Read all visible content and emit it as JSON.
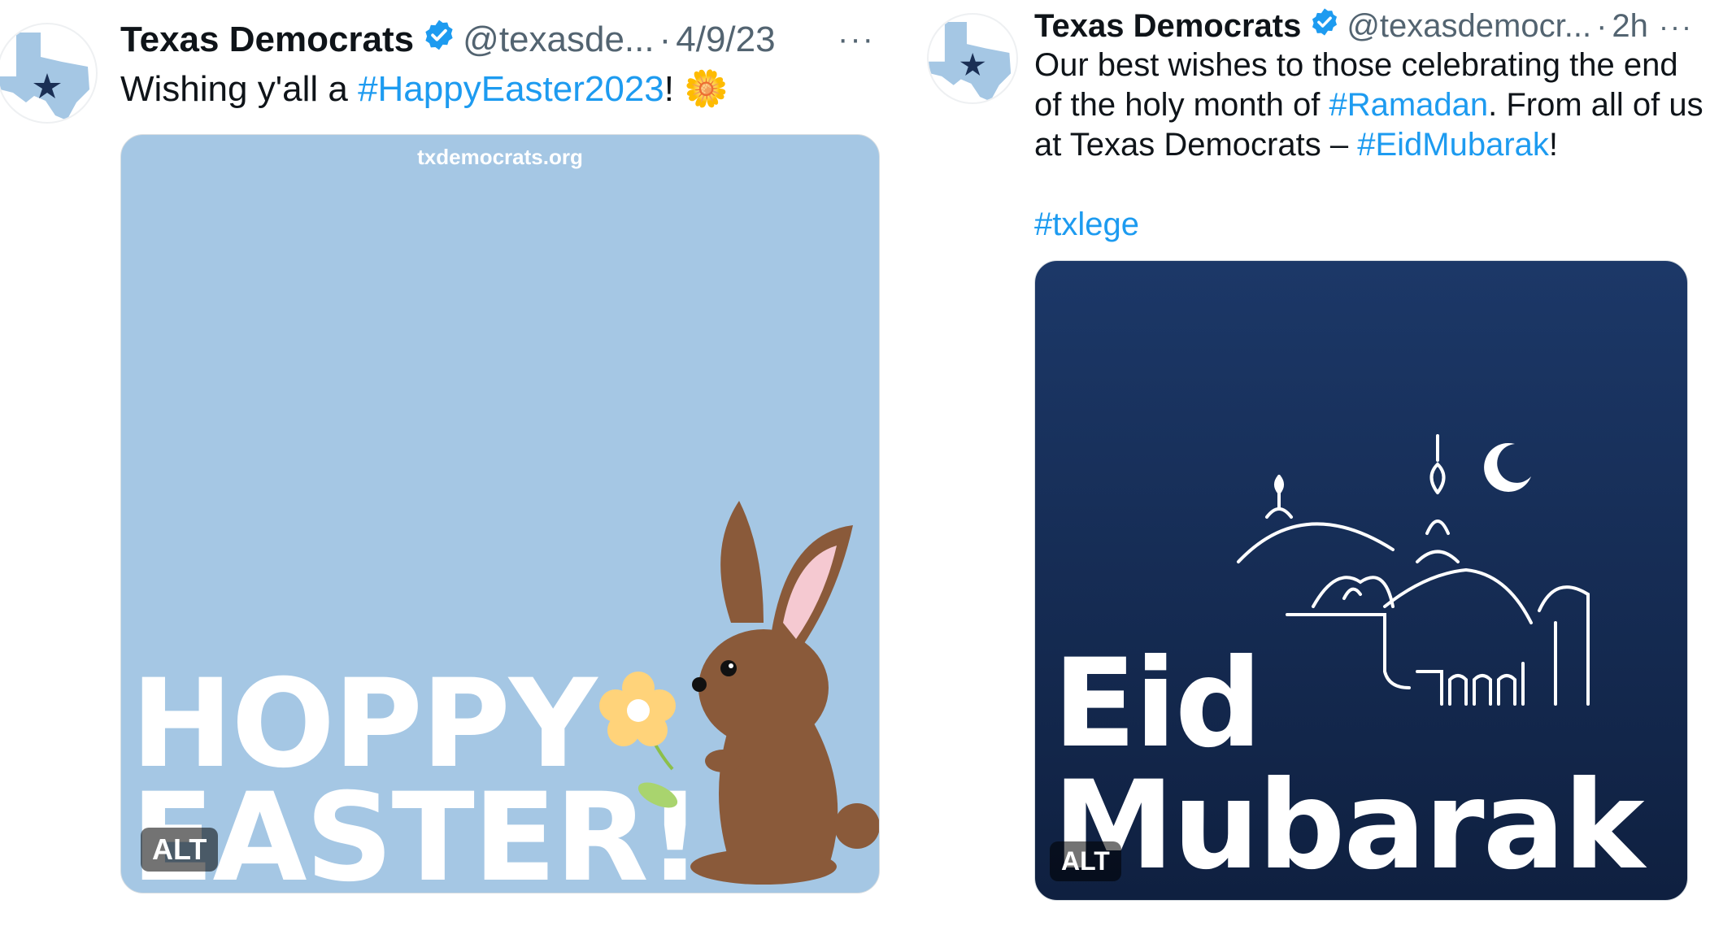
{
  "tweet1": {
    "author_name": "Texas Democrats",
    "handle": "@texasde...",
    "separator": "·",
    "time": "4/9/23",
    "more_label": "···",
    "text_pre": "Wishing y'all a ",
    "hashtag": "#HappyEaster2023",
    "text_post": "! ",
    "emoji": "🌼",
    "media": {
      "site": "txdemocrats.org",
      "line1": "HOPPY",
      "line2": "EASTER!",
      "alt_badge": "ALT",
      "bg_color": "#a5c7e4"
    }
  },
  "tweet2": {
    "author_name": "Texas Democrats",
    "handle": "@texasdemocr...",
    "separator": "·",
    "time": "2h",
    "more_label": "···",
    "line1": "Our best wishes to those celebrating the end",
    "line2_pre": "of the holy month of ",
    "hashtag_ramadan": "#Ramadan",
    "line2_post": ". From all of us",
    "line3_pre": "at Texas Democrats – ",
    "hashtag_eid": "#EidMubarak",
    "line3_post": "!",
    "hashtag_txlege": "#txlege",
    "media": {
      "line1": "Eid",
      "line2": "Mubarak",
      "alt_badge": "ALT",
      "bg_top": "#1c3868",
      "bg_bottom": "#0f2040"
    }
  },
  "colors": {
    "link": "#1d9bf0",
    "verified": "#1d9bf0",
    "secondary_text": "#536471",
    "texas_blue": "#a5c7e4",
    "texas_star": "#1a2f55"
  }
}
